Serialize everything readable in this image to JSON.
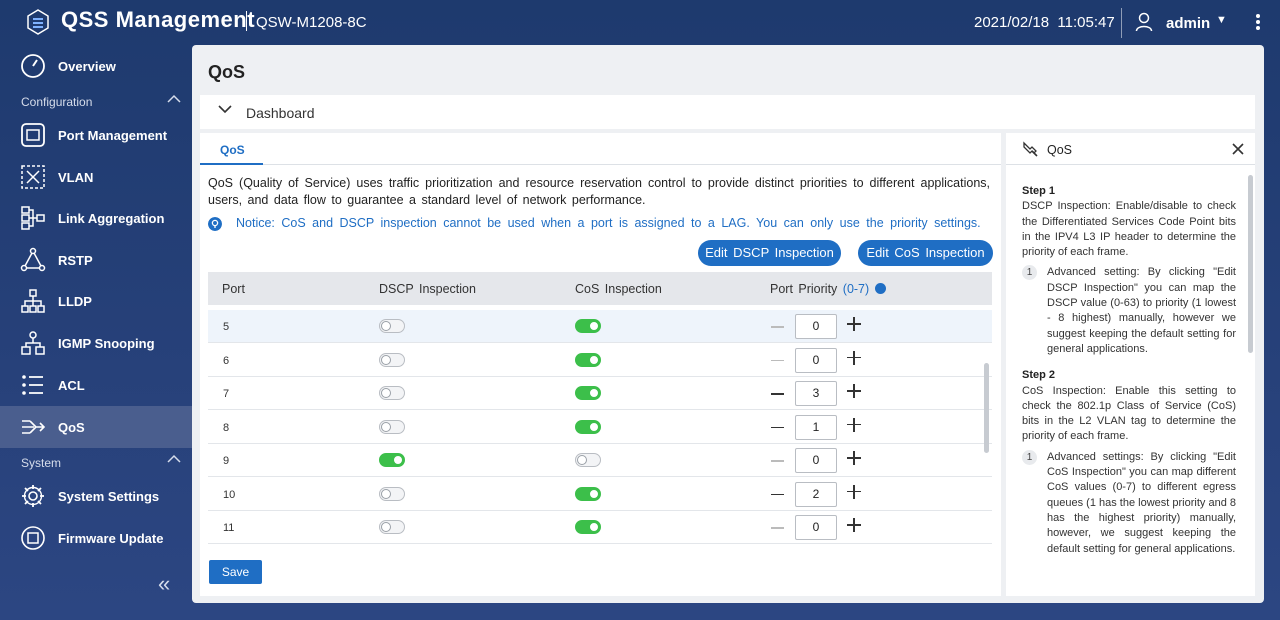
{
  "header": {
    "app_title": "QSS Management",
    "device_name": "QSW-M1208-8C",
    "datetime": "2021/02/18  11:05:47",
    "user": "admin"
  },
  "sidebar": {
    "top_items": [
      {
        "label": "Overview",
        "icon": "overview-icon"
      }
    ],
    "config_section": "Configuration",
    "config_items": [
      {
        "label": "Port Management",
        "icon": "port-management-icon"
      },
      {
        "label": "VLAN",
        "icon": "vlan-icon"
      },
      {
        "label": "Link Aggregation",
        "icon": "link-aggregation-icon"
      },
      {
        "label": "RSTP",
        "icon": "rstp-icon"
      },
      {
        "label": "LLDP",
        "icon": "lldp-icon"
      },
      {
        "label": "IGMP Snooping",
        "icon": "igmp-snooping-icon"
      },
      {
        "label": "ACL",
        "icon": "acl-icon"
      },
      {
        "label": "QoS",
        "icon": "qos-icon",
        "active": true
      }
    ],
    "system_section": "System",
    "system_items": [
      {
        "label": "System Settings",
        "icon": "gear-icon"
      },
      {
        "label": "Firmware Update",
        "icon": "firmware-icon"
      }
    ]
  },
  "page": {
    "title": "QoS",
    "dashboard_label": "Dashboard",
    "tab_label": "QoS",
    "description": "QoS (Quality of Service) uses traffic prioritization and resource reservation control to provide distinct priorities to different applications, users, and data flow to guarantee a standard level of network performance.",
    "notice": "Notice: CoS and DSCP inspection cannot be used when a port is assigned to a LAG. You can only use the priority settings.",
    "edit_dscp_label": "Edit DSCP Inspection",
    "edit_cos_label": "Edit CoS Inspection",
    "save_label": "Save"
  },
  "table": {
    "headers": {
      "port": "Port",
      "dscp": "DSCP Inspection",
      "cos": "CoS Inspection",
      "priority": "Port Priority",
      "priority_range": "(0-7)"
    },
    "rows": [
      {
        "port": "5",
        "dscp": false,
        "cos": true,
        "priority": "0"
      },
      {
        "port": "6",
        "dscp": false,
        "cos": true,
        "priority": "0"
      },
      {
        "port": "7",
        "dscp": false,
        "cos": true,
        "priority": "3"
      },
      {
        "port": "8",
        "dscp": false,
        "cos": true,
        "priority": "1"
      },
      {
        "port": "9",
        "dscp": true,
        "cos": false,
        "priority": "0"
      },
      {
        "port": "10",
        "dscp": false,
        "cos": true,
        "priority": "2"
      },
      {
        "port": "11",
        "dscp": false,
        "cos": true,
        "priority": "0"
      }
    ]
  },
  "help": {
    "title": "QoS",
    "step1_heading": "Step 1",
    "step1_text": "DSCP Inspection: Enable/disable to check the Differentiated Services Code Point bits in the IPV4 L3 IP header to determine the priority of each frame.",
    "step1_sub_num": "1",
    "step1_sub_text": "Advanced setting: By clicking \"Edit DSCP Inspection\" you can map the DSCP value (0-63) to priority (1 lowest - 8 highest) manually, however we suggest keeping the default setting for general applications.",
    "step2_heading": "Step 2",
    "step2_text": "CoS Inspection: Enable this setting to check the 802.1p Class of Service (CoS) bits in the L2 VLAN tag to determine the priority of each frame.",
    "step2_sub_num": "1",
    "step2_sub_text": "Advanced settings: By clicking \"Edit CoS Inspection\" you can map different CoS values (0-7) to different egress queues (1 has the lowest priority and 8 has the highest priority) manually, however, we suggest keeping the default setting for general applications."
  },
  "colors": {
    "accent": "#1f6ec4",
    "toggle_on": "#3cbf4a",
    "sidebar_bg": "#1e3a6e"
  }
}
